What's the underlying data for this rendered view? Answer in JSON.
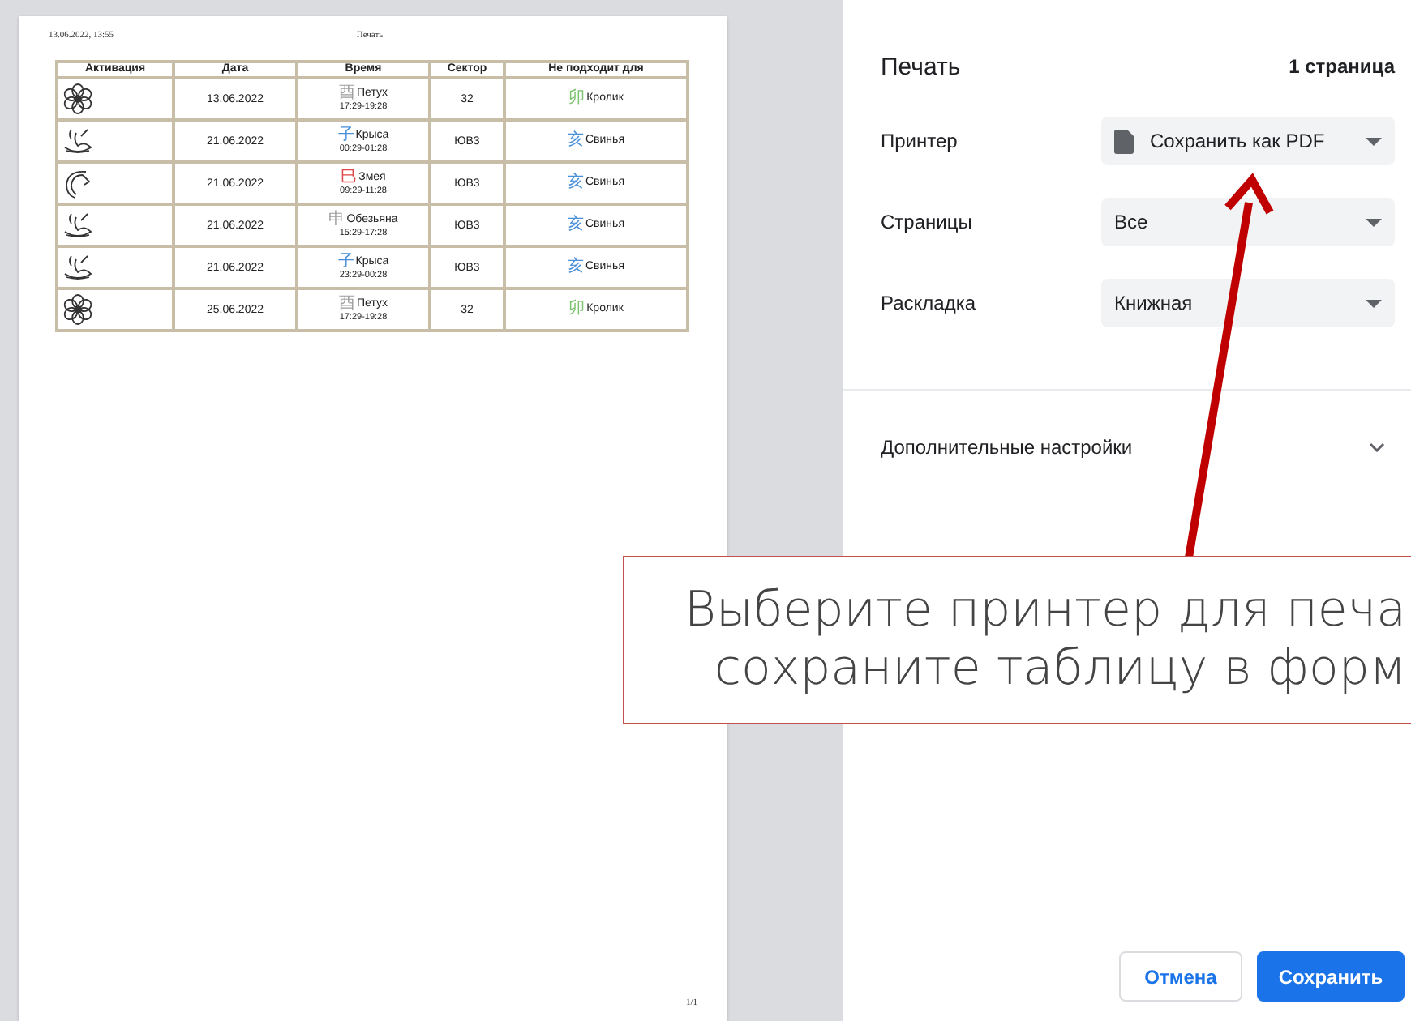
{
  "preview": {
    "header_date": "13.06.2022, 13:55",
    "header_title": "Печать",
    "page_number": "1/1",
    "table": {
      "columns": [
        "Активация",
        "Дата",
        "Время",
        "Сектор",
        "Не подходит для"
      ],
      "rows": [
        {
          "activation": {
            "kind": "flower"
          },
          "date": "13.06.2022",
          "time": {
            "glyph": "酉",
            "color": "#9e9e9e",
            "animal": "Петух",
            "range": "17:29-19:28"
          },
          "sector": "32",
          "incompatible": {
            "glyph": "卯",
            "color": "#7cc36f",
            "animal": "Кролик"
          }
        },
        {
          "activation": {
            "kind": "swirl"
          },
          "date": "21.06.2022",
          "time": {
            "glyph": "子",
            "color": "#4a90d9",
            "animal": "Крыса",
            "range": "00:29-01:28"
          },
          "sector": "ЮВ3",
          "incompatible": {
            "glyph": "亥",
            "color": "#4a90d9",
            "animal": "Свинья"
          }
        },
        {
          "activation": {
            "kind": "crescent"
          },
          "date": "21.06.2022",
          "time": {
            "glyph": "巳",
            "color": "#e04848",
            "animal": "Змея",
            "range": "09:29-11:28"
          },
          "sector": "ЮВ3",
          "incompatible": {
            "glyph": "亥",
            "color": "#4a90d9",
            "animal": "Свинья"
          }
        },
        {
          "activation": {
            "kind": "swirl"
          },
          "date": "21.06.2022",
          "time": {
            "glyph": "申",
            "color": "#9e9e9e",
            "animal": "Обезьяна",
            "range": "15:29-17:28"
          },
          "sector": "ЮВ3",
          "incompatible": {
            "glyph": "亥",
            "color": "#4a90d9",
            "animal": "Свинья"
          }
        },
        {
          "activation": {
            "kind": "swirl"
          },
          "date": "21.06.2022",
          "time": {
            "glyph": "子",
            "color": "#4a90d9",
            "animal": "Крыса",
            "range": "23:29-00:28"
          },
          "sector": "ЮВ3",
          "incompatible": {
            "glyph": "亥",
            "color": "#4a90d9",
            "animal": "Свинья"
          }
        },
        {
          "activation": {
            "kind": "flower"
          },
          "date": "25.06.2022",
          "time": {
            "glyph": "酉",
            "color": "#9e9e9e",
            "animal": "Петух",
            "range": "17:29-19:28"
          },
          "sector": "32",
          "incompatible": {
            "glyph": "卯",
            "color": "#7cc36f",
            "animal": "Кролик"
          }
        }
      ]
    }
  },
  "panel": {
    "title": "Печать",
    "page_count": "1 страница",
    "settings": [
      {
        "label": "Принтер",
        "value": "Сохранить как PDF",
        "kind": "destination"
      },
      {
        "label": "Страницы",
        "value": "Все",
        "kind": "plain"
      },
      {
        "label": "Раскладка",
        "value": "Книжная",
        "kind": "plain"
      }
    ],
    "more_settings": {
      "label": "Дополнительные настройки",
      "expanded": false
    },
    "buttons": [
      {
        "label": "Отмена",
        "kind": "secondary"
      },
      {
        "label": "Сохранить",
        "kind": "primary"
      }
    ]
  },
  "callout": {
    "lines": [
      "Выберите принтер для печа",
      "сохраните таблицу в форм"
    ]
  }
}
